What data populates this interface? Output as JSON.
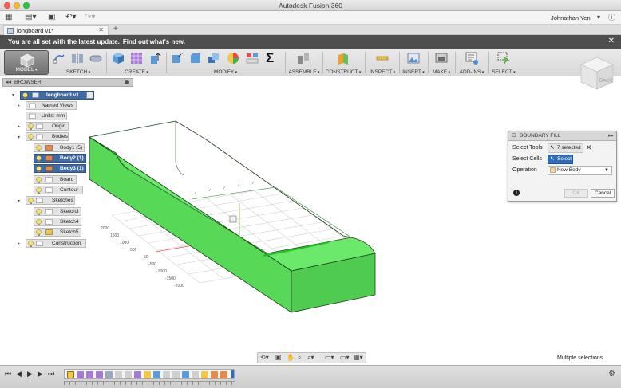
{
  "window": {
    "title": "Autodesk Fusion 360"
  },
  "appbar": {
    "user": "Johnathan Yen"
  },
  "tabs": [
    {
      "label": "longboard v1*"
    }
  ],
  "notification": {
    "message": "You are all set with the latest update.",
    "link": "Find out what's new."
  },
  "toolbar": {
    "groups": [
      {
        "label": "MODEL"
      },
      {
        "label": "SKETCH"
      },
      {
        "label": "CREATE"
      },
      {
        "label": "MODIFY"
      },
      {
        "label": "ASSEMBLE"
      },
      {
        "label": "CONSTRUCT"
      },
      {
        "label": "INSPECT"
      },
      {
        "label": "INSERT"
      },
      {
        "label": "MAKE"
      },
      {
        "label": "ADD-INS"
      },
      {
        "label": "SELECT"
      }
    ],
    "sigma": "Σ"
  },
  "browser": {
    "title": "BROWSER",
    "nodes": [
      {
        "label": "longboard v1"
      },
      {
        "label": "Named Views"
      },
      {
        "label": "Units: mm"
      },
      {
        "label": "Origin"
      },
      {
        "label": "Bodies"
      },
      {
        "label": "Body1 (5)"
      },
      {
        "label": "Body2 (1)"
      },
      {
        "label": "Body3 (1)"
      },
      {
        "label": "Board"
      },
      {
        "label": "Contour"
      },
      {
        "label": "Sketches"
      },
      {
        "label": "Sketch3"
      },
      {
        "label": "Sketch4"
      },
      {
        "label": "Sketch5"
      },
      {
        "label": "Construction"
      }
    ]
  },
  "boundary_fill": {
    "title": "BOUNDARY FILL",
    "select_tools_label": "Select Tools",
    "select_tools_value": "7 selected",
    "select_cells_label": "Select Cells",
    "select_button": "Select",
    "operation_label": "Operation",
    "operation_value": "New Body",
    "ok": "OK",
    "cancel": "Cancel"
  },
  "viewcube": {
    "face": "BACK"
  },
  "grid": {
    "labels": [
      "2000",
      "1500",
      "1000",
      "500",
      "50",
      "-500",
      "-1000",
      "-1500",
      "-2000"
    ]
  },
  "status": {
    "text": "Multiple selections"
  },
  "colors": {
    "body_fill": "#5fe05f",
    "notification_bg": "#4e4e4e",
    "selected_node": "#3f6aa3",
    "select_button": "#2f6db5"
  }
}
